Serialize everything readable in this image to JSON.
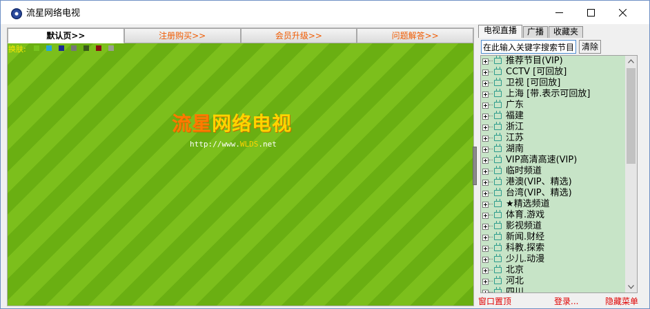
{
  "window": {
    "title": "流星网络电视",
    "controls": [
      "minimize-icon",
      "maximize-icon",
      "close-icon"
    ]
  },
  "nav": {
    "tabs": [
      "默认页>>",
      "注册购买>>",
      "会员升级>>",
      "问题解答>>"
    ],
    "active_index": 0
  },
  "skin": {
    "label": "换肤:",
    "colors": [
      "#78c41e",
      "#28a8d8",
      "#1a2a90",
      "#777777",
      "#3a5a1a",
      "#8a1010",
      "#9aa090"
    ]
  },
  "logo": {
    "text_highlight": "流星",
    "text_rest": "网络电视",
    "url_prefix": "http://www.",
    "url_domain": "WLDS",
    "url_suffix": ".net"
  },
  "side": {
    "tabs": [
      "电视直播",
      "广播",
      "收藏夹"
    ],
    "active_tab": 0,
    "search_value": "在此输入关键字搜索节目",
    "clear_label": "清除",
    "channels": [
      "推荐节目(VIP)",
      "CCTV [可回放]",
      "卫视 [可回放]",
      "上海 [带.表示可回放]",
      "广东",
      "福建",
      "浙江",
      "江苏",
      "湖南",
      "VIP高清高速(VIP)",
      "临时频道",
      "港澳(VIP、精选)",
      "台湾(VIP、精选)",
      "★精选频道",
      "体育.游戏",
      "影视频道",
      "新闻.财经",
      "科教.探索",
      "少儿.动漫",
      "北京",
      "河北",
      "四川"
    ],
    "footer": {
      "pin": "窗口置顶",
      "login": "登录...",
      "hide_menu": "隐藏菜单"
    }
  }
}
